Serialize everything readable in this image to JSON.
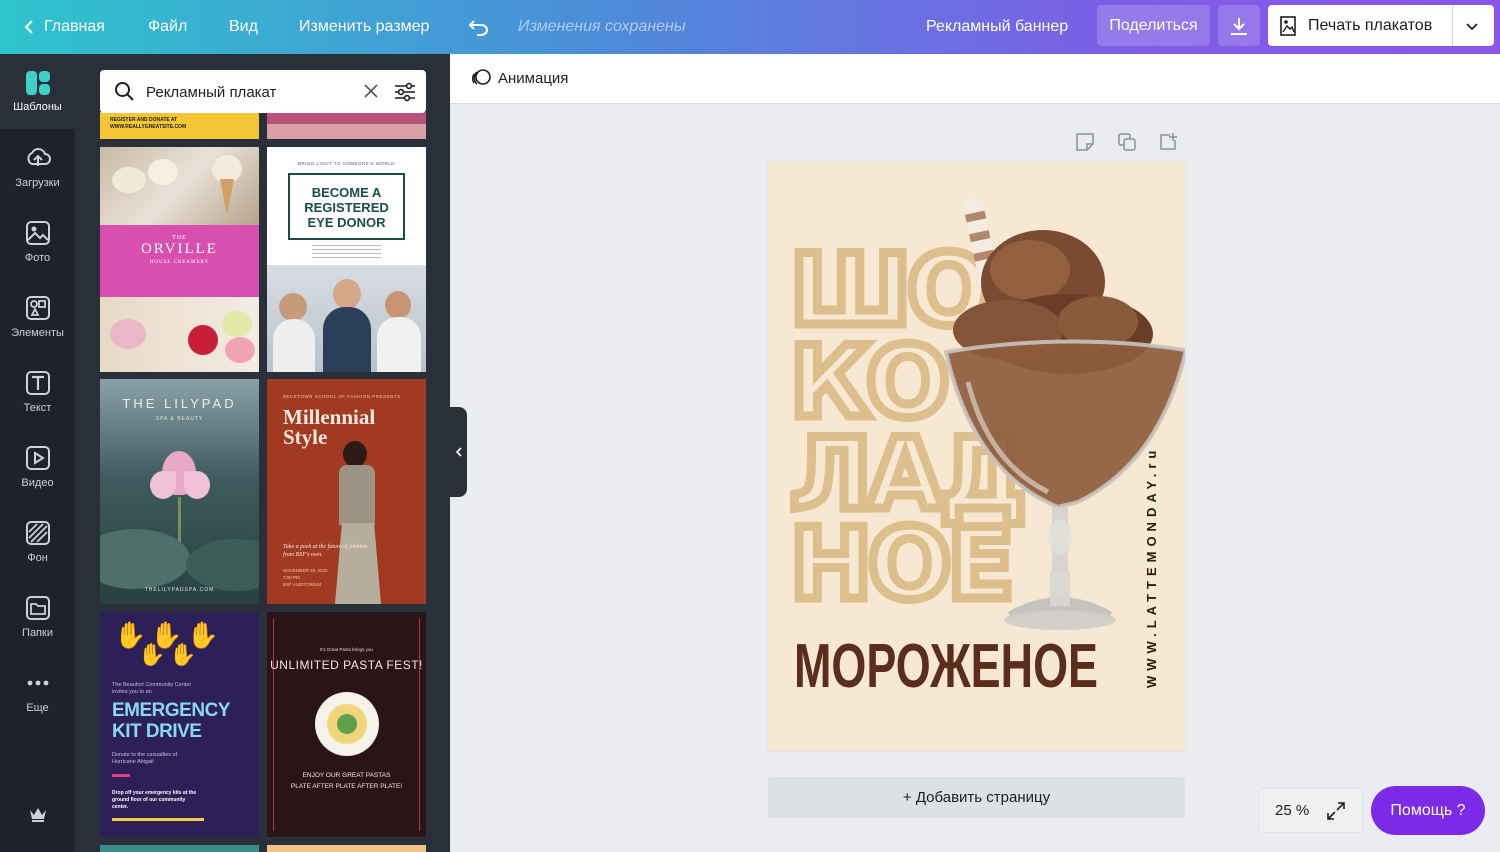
{
  "topbar": {
    "home": "Главная",
    "file": "Файл",
    "view": "Вид",
    "resize": "Изменить размер",
    "saved_status": "Изменения сохранены",
    "doc_title": "Рекламный баннер",
    "share": "Поделиться",
    "print": "Печать плакатов"
  },
  "rail": {
    "items": [
      {
        "label": "Шаблоны",
        "icon": "templates-icon"
      },
      {
        "label": "Загрузки",
        "icon": "upload-icon"
      },
      {
        "label": "Фото",
        "icon": "photo-icon"
      },
      {
        "label": "Элементы",
        "icon": "elements-icon"
      },
      {
        "label": "Текст",
        "icon": "text-icon"
      },
      {
        "label": "Видео",
        "icon": "video-icon"
      },
      {
        "label": "Фон",
        "icon": "background-icon"
      },
      {
        "label": "Папки",
        "icon": "folder-icon"
      },
      {
        "label": "Еще",
        "icon": "more-icon"
      }
    ]
  },
  "search": {
    "value": "Рекламный плакат"
  },
  "templates": {
    "top_strip_left": "REGISTER AND DONATE AT\nWWW.REALLYGREATSITE.COM",
    "orville": {
      "the": "THE",
      "title": "ORVILLE",
      "sub": "HOUSE CREAMERY"
    },
    "eye": {
      "top": "BRING LIGHT TO SOMEONE'S WORLD",
      "line1": "BECOME A",
      "line2": "REGISTERED",
      "line3": "EYE DONOR"
    },
    "lilypad": {
      "title": "THE LILYPAD",
      "sub": "SPA & BEAUTY",
      "site": "THELILYPADSPA.COM"
    },
    "millennial": {
      "top": "BECKTOWN SCHOOL OF FASHION PRESENTS",
      "line1": "Millennial",
      "line2": "Style",
      "desc": "Take a peek at the future of fashion from BSF's own.",
      "date": "NOVEMBER 28, 2020",
      "time": "7:00 PM",
      "place": "BSF AUDITORIUM"
    },
    "emergency": {
      "intro": "The Beaufort Community Center invites you to an",
      "line1": "EMERGENCY",
      "line2": "KIT DRIVE",
      "donate": "Donate to the casualties of Hurricane Abigail",
      "drop": "Drop off your emergency kits at the ground floor of our community center."
    },
    "pasta": {
      "top": "It's Great Pasta brings you",
      "title": "UNLIMITED PASTA FEST!",
      "line1": "ENJOY OUR GREAT PASTAS",
      "line2": "PLATE AFTER PLATE AFTER PLATE!"
    }
  },
  "editor": {
    "animation": "Анимация",
    "add_page": "+ Добавить страницу",
    "zoom": "25 %",
    "help": "Помощь  ?"
  },
  "poster": {
    "big_lines": [
      "ШО",
      "КО",
      "ЛАД",
      "НОЕ"
    ],
    "subtitle": "МОРОЖЕНОЕ",
    "site": "WWW.LATTEMONDAY.ru",
    "colors": {
      "bg": "#f6e8d3",
      "tan": "#dcbf8d",
      "brown": "#5a2e1e"
    }
  }
}
